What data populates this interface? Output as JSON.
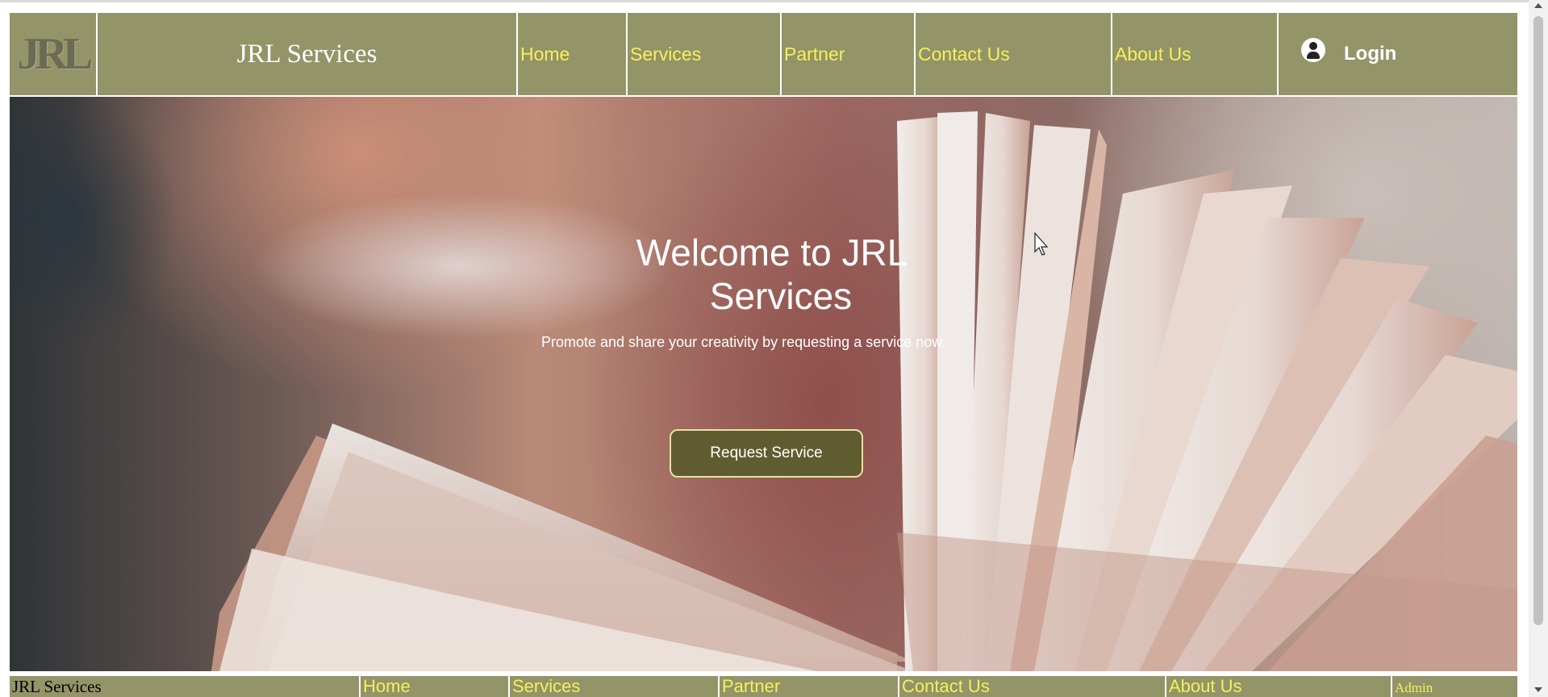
{
  "header": {
    "logo_text": "JRL",
    "brand": "JRL Services",
    "nav": [
      "Home",
      "Services",
      "Partner",
      "Contact Us",
      "About Us"
    ],
    "login_label": "Login"
  },
  "hero": {
    "title_line1": "Welcome to JRL",
    "title_line2": "Services",
    "subtitle": "Promote and share your creativity by requesting a service now.",
    "cta_label": "Request Service"
  },
  "footer": {
    "brand": "JRL Services",
    "nav": [
      "Home",
      "Services",
      "Partner",
      "Contact Us",
      "About Us"
    ],
    "admin_label": "Admin"
  },
  "colors": {
    "bar_olive": "#939468",
    "nav_link_yellow": "#f7f05a",
    "cta_fill": "#5f5d2f",
    "cta_border": "#e6e2a2"
  },
  "icons": {
    "login": "user-circle-icon",
    "cursor": "mouse-pointer-icon"
  }
}
